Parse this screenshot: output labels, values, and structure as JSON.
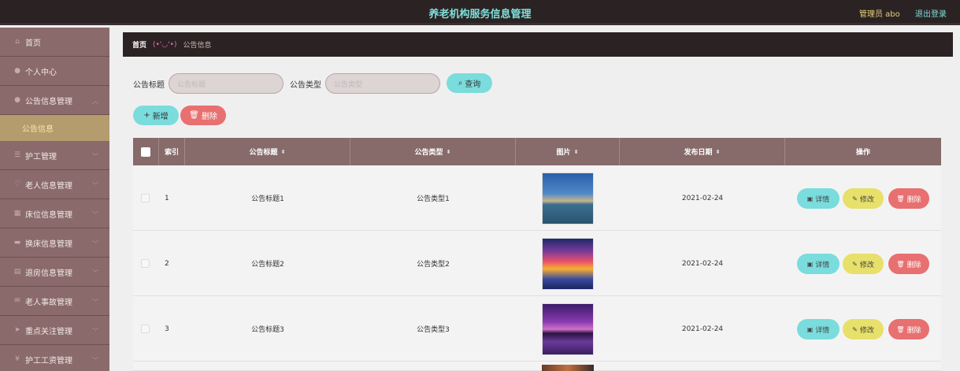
{
  "header": {
    "title": "养老机构服务信息管理",
    "admin": "管理员 abo",
    "logout": "退出登录"
  },
  "sidebar": {
    "items": [
      {
        "label": "首页",
        "icon": "home-icon"
      },
      {
        "label": "个人中心",
        "icon": "user-icon"
      },
      {
        "label": "公告信息管理",
        "icon": "user-icon"
      },
      {
        "label": "护工管理",
        "icon": "list-icon"
      },
      {
        "label": "老人信息管理",
        "icon": "heart-icon"
      },
      {
        "label": "床位信息管理",
        "icon": "grid-icon"
      },
      {
        "label": "换床信息管理",
        "icon": "bed-icon"
      },
      {
        "label": "退房信息管理",
        "icon": "doc-icon"
      },
      {
        "label": "老人事故管理",
        "icon": "mail-icon"
      },
      {
        "label": "重点关注管理",
        "icon": "send-icon"
      },
      {
        "label": "护工工资管理",
        "icon": "money-icon"
      }
    ],
    "sub_item": "公告信息"
  },
  "breadcrumb": {
    "home": "首页",
    "sep": "(•'◡'•)",
    "current": "公告信息"
  },
  "search": {
    "title_label": "公告标题",
    "title_placeholder": "公告标题",
    "type_label": "公告类型",
    "type_placeholder": "公告类型",
    "query": "查询"
  },
  "actions": {
    "add": "新增",
    "delete": "删除"
  },
  "table": {
    "headers": {
      "index": "索引",
      "title": "公告标题",
      "type": "公告类型",
      "image": "图片",
      "date": "发布日期",
      "ops": "操作"
    },
    "rows": [
      {
        "index": "1",
        "title": "公告标题1",
        "type": "公告类型1",
        "date": "2021-02-24"
      },
      {
        "index": "2",
        "title": "公告标题2",
        "type": "公告类型2",
        "date": "2021-02-24"
      },
      {
        "index": "3",
        "title": "公告标题3",
        "type": "公告类型3",
        "date": "2021-02-24"
      }
    ],
    "row_actions": {
      "detail": "详情",
      "edit": "修改",
      "delete": "删除"
    }
  }
}
